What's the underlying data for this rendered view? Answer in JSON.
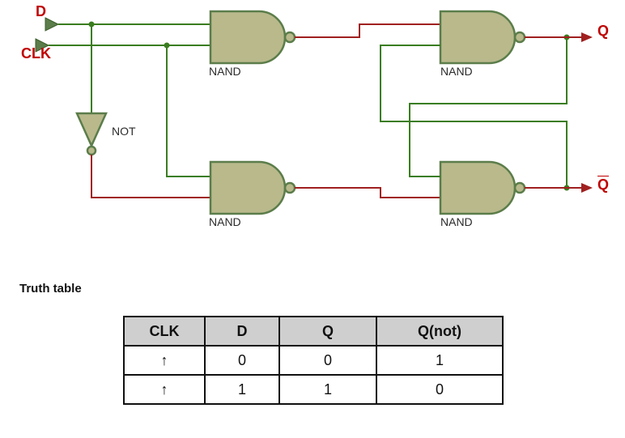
{
  "circuit": {
    "inputs": {
      "d": "D",
      "clk": "CLK"
    },
    "outputs": {
      "q": "Q",
      "qbar": "Q"
    },
    "gates": {
      "not": "NOT",
      "nand1": "NAND",
      "nand2": "NAND",
      "nand3": "NAND",
      "nand4": "NAND"
    },
    "colors": {
      "gate_fill": "#b9b98c",
      "gate_stroke": "#5b7d4a",
      "wire_green": "#3a7d1f",
      "wire_red": "#a02020",
      "label_red": "#c00000"
    },
    "diagram_type": "D flip-flop (NAND-based latch)"
  },
  "truth_table_title": "Truth table",
  "chart_data": {
    "type": "table",
    "title": "Truth table",
    "headers": {
      "clk": "CLK",
      "d": "D",
      "q": "Q",
      "qn": "Q(not)"
    },
    "rows": [
      {
        "clk": "↑",
        "d": "0",
        "q": "0",
        "qn": "1"
      },
      {
        "clk": "↑",
        "d": "1",
        "q": "1",
        "qn": "0"
      }
    ]
  }
}
